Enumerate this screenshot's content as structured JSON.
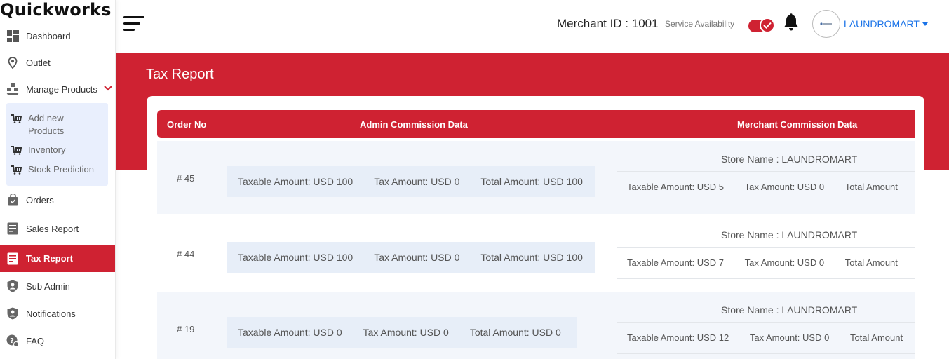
{
  "brand": "Quickworks",
  "sidebar": {
    "items": [
      {
        "label": "Dashboard"
      },
      {
        "label": "Outlet"
      },
      {
        "label": "Manage Products"
      },
      {
        "label": "Orders"
      },
      {
        "label": "Sales Report"
      },
      {
        "label": "Tax Report"
      },
      {
        "label": "Sub Admin"
      },
      {
        "label": "Notifications"
      },
      {
        "label": "FAQ"
      }
    ],
    "submenu": [
      {
        "label": "Add new Products"
      },
      {
        "label": "Inventory"
      },
      {
        "label": "Stock Prediction"
      }
    ],
    "active": "Tax Report"
  },
  "header": {
    "merchant_id": "Merchant ID : 1001",
    "service_label": "Service Availability",
    "service_on": true,
    "user_name": "LAUNDROMART"
  },
  "page": {
    "title": "Tax Report"
  },
  "table": {
    "columns": [
      "Order No",
      "Admin Commission Data",
      "Merchant Commission Data"
    ],
    "rows": [
      {
        "order": "# 45",
        "admin": {
          "taxable": "Taxable Amount: USD 100",
          "tax": "Tax Amount: USD 0",
          "total": "Total Amount: USD 100"
        },
        "store": "Store Name : LAUNDROMART",
        "merchant": {
          "taxable": "Taxable Amount: USD 5",
          "tax": "Tax Amount: USD 0",
          "total": "Total Amount"
        }
      },
      {
        "order": "# 44",
        "admin": {
          "taxable": "Taxable Amount: USD 100",
          "tax": "Tax Amount: USD 0",
          "total": "Total Amount: USD 100"
        },
        "store": "Store Name : LAUNDROMART",
        "merchant": {
          "taxable": "Taxable Amount: USD 7",
          "tax": "Tax Amount: USD 0",
          "total": "Total Amount"
        }
      },
      {
        "order": "# 19",
        "admin": {
          "taxable": "Taxable Amount: USD 0",
          "tax": "Tax Amount: USD 0",
          "total": "Total Amount: USD 0"
        },
        "store": "Store Name : LAUNDROMART",
        "merchant": {
          "taxable": "Taxable Amount: USD 12",
          "tax": "Tax Amount: USD 0",
          "total": "Total Amount"
        }
      }
    ]
  },
  "colors": {
    "accent": "#cf2232",
    "link": "#1a73e8",
    "submenu_bg": "#e9effd"
  },
  "icons": [
    "dashboard-icon",
    "location-pin-icon",
    "products-icon",
    "chevron-down-icon",
    "cart-icon",
    "orders-bag-icon",
    "report-icon",
    "user-shield-icon",
    "faq-icon",
    "bell-icon",
    "hamburger-icon",
    "check-icon"
  ]
}
